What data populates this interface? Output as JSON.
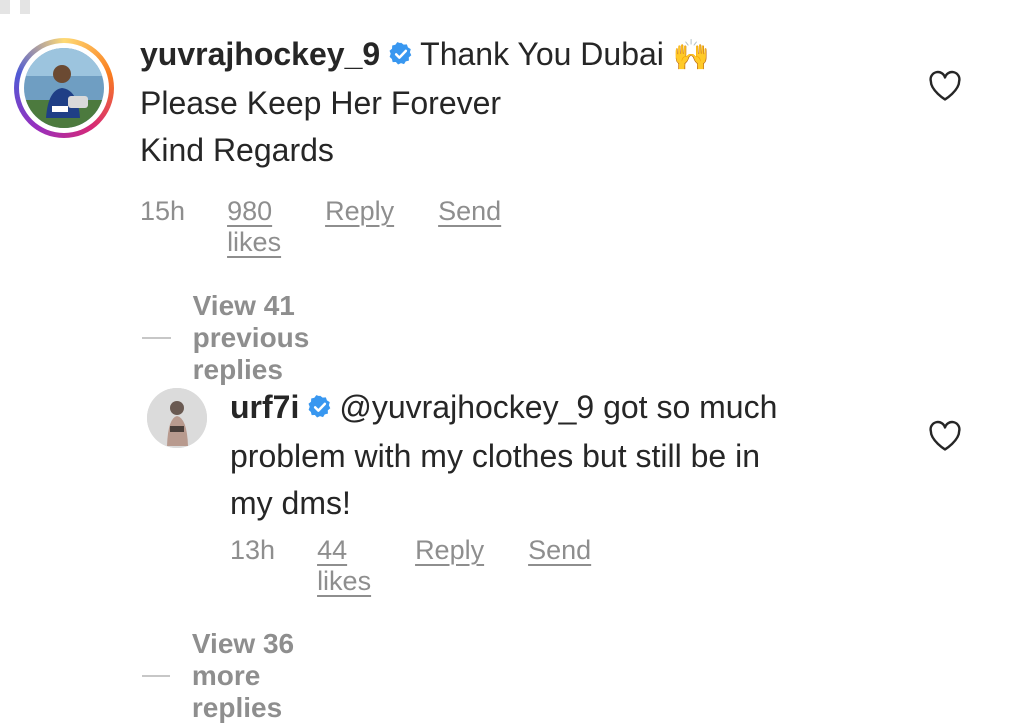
{
  "comments": [
    {
      "username": "yuvrajhockey_9",
      "text_line1": "Thank You Dubai",
      "emoji": "🙌",
      "text_line2": "Please Keep Her Forever",
      "text_line3": "Kind Regards",
      "time": "15h",
      "likes": "980 likes",
      "reply": "Reply",
      "send": "Send",
      "view_replies": "View 41 previous replies"
    },
    {
      "username": "urf7i",
      "mention": "@yuvrajhockey_9",
      "text_line1_rest": "got so much",
      "text_line2": "problem with my clothes but still be in",
      "text_line3": "my dms!",
      "time": "13h",
      "likes": "44 likes",
      "reply": "Reply",
      "send": "Send",
      "view_replies": "View 36 more replies"
    }
  ],
  "icons": {
    "verified": "verified-badge-icon",
    "heart": "heart-outline-icon"
  },
  "colors": {
    "verified_blue": "#3897f0",
    "text": "#262626",
    "secondary": "#8e8e8e"
  }
}
